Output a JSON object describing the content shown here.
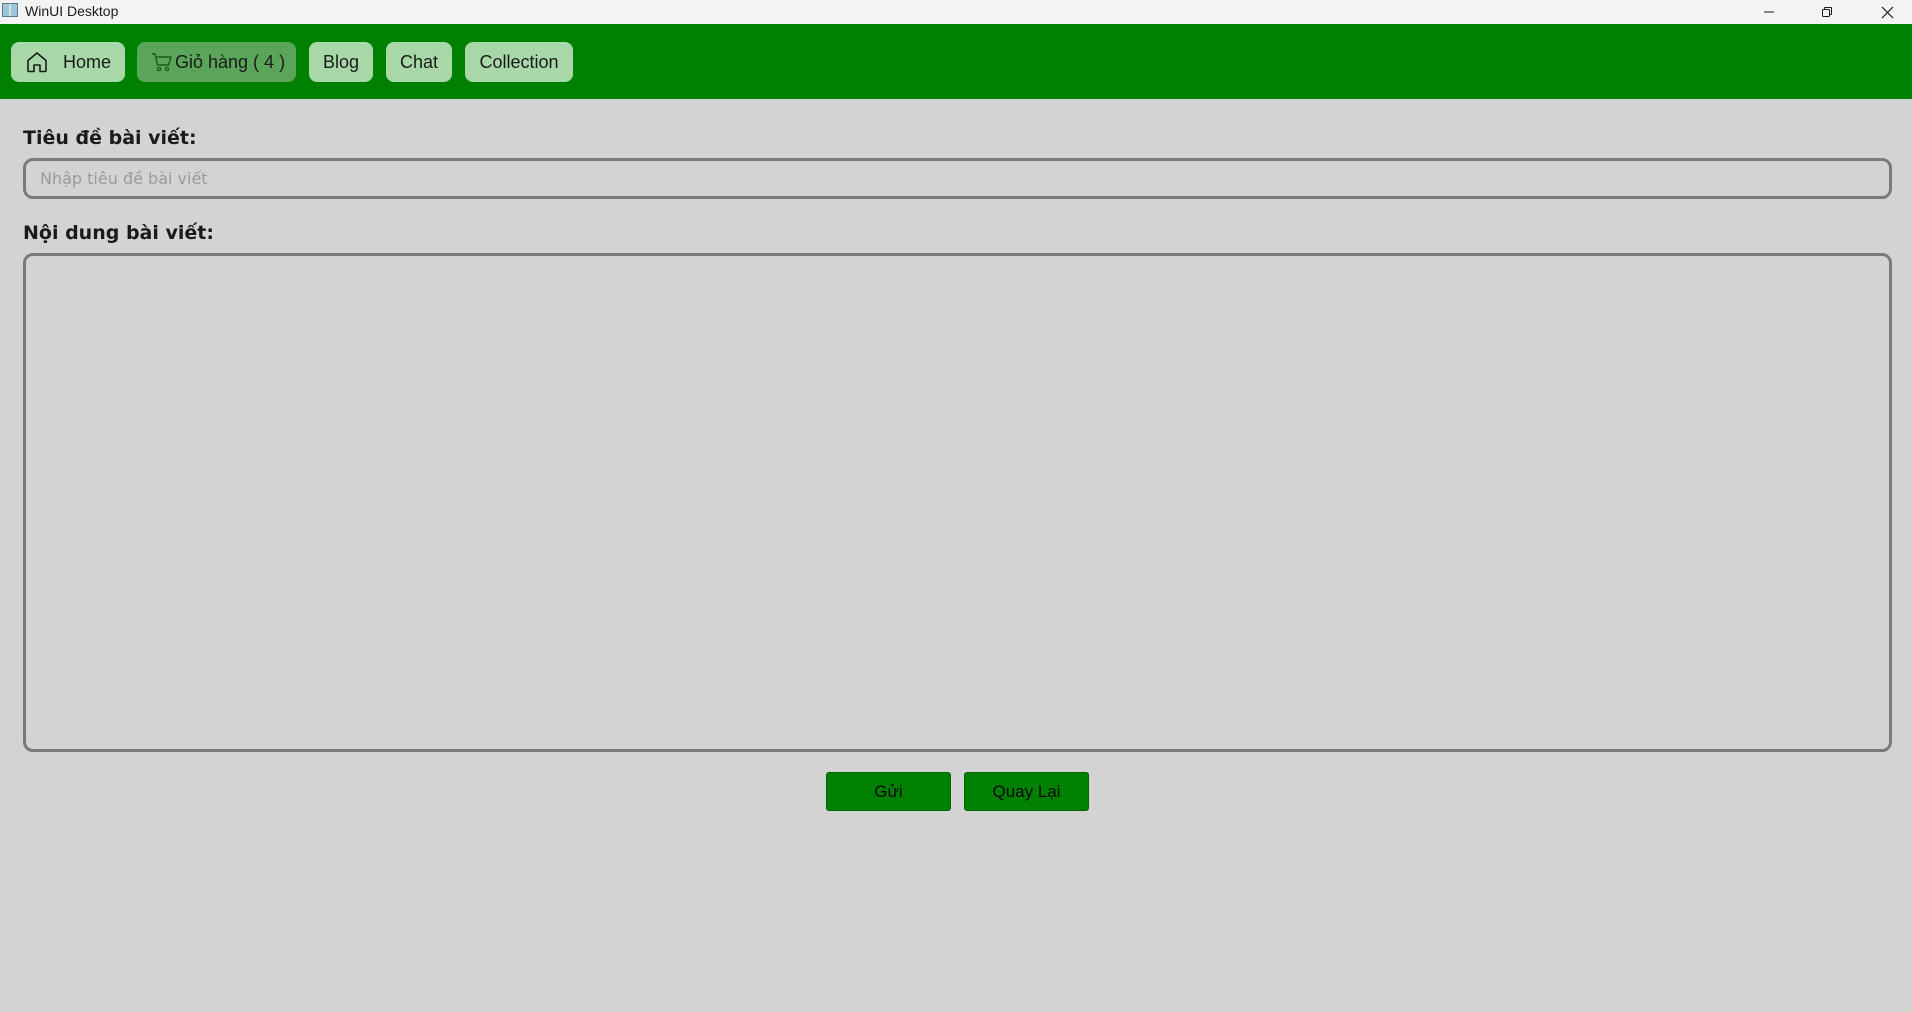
{
  "window": {
    "title": "WinUI Desktop"
  },
  "nav": {
    "home_label": "Home",
    "cart_label": "Giỏ hàng ( 4 )",
    "blog_label": "Blog",
    "chat_label": "Chat",
    "collection_label": "Collection"
  },
  "form": {
    "title_label": "Tiêu đề bài viết:",
    "title_placeholder": "Nhập tiêu đề bài viết",
    "title_value": "",
    "content_label": "Nội dung bài viết:",
    "content_value": ""
  },
  "actions": {
    "send_label": "Gửi",
    "back_label": "Quay Lại"
  },
  "colors": {
    "nav_background": "#008000",
    "nav_button": "#a8d8a8",
    "nav_button_active": "#5aa55a",
    "page_background": "#d3d3d3",
    "action_button": "#008000"
  },
  "icons": {
    "home": "home-icon",
    "cart": "cart-icon"
  }
}
